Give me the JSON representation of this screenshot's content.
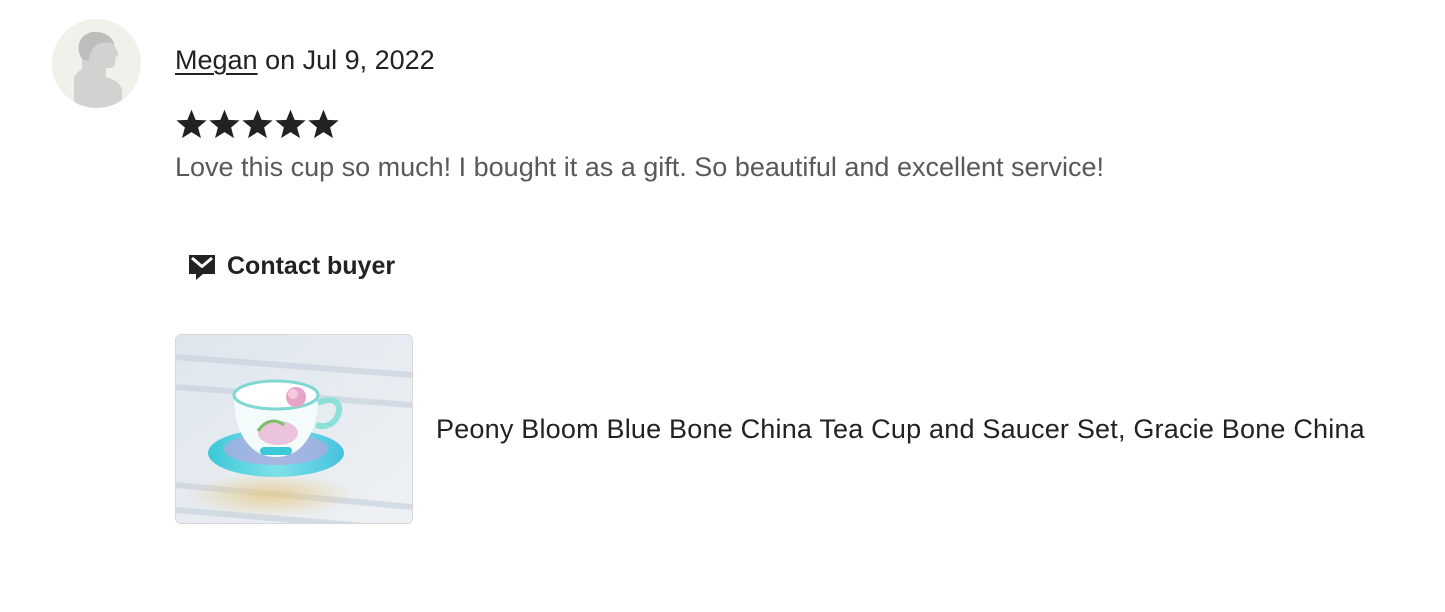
{
  "review": {
    "reviewer_name": "Megan",
    "date_text": " on Jul 9, 2022",
    "rating": 5,
    "rating_max": 5,
    "text": "Love this cup so much! I bought it as a gift. So beautiful and excellent service!"
  },
  "contact_button": {
    "label": "Contact buyer",
    "icon": "envelope-icon"
  },
  "product": {
    "title": "Peony Bloom Blue Bone China Tea Cup and Saucer Set, Gracie Bone China",
    "thumbnail": "teacup-photo"
  },
  "colors": {
    "star": "#222222",
    "review_text": "#595959",
    "avatar_bg": "#f1f1ec"
  }
}
